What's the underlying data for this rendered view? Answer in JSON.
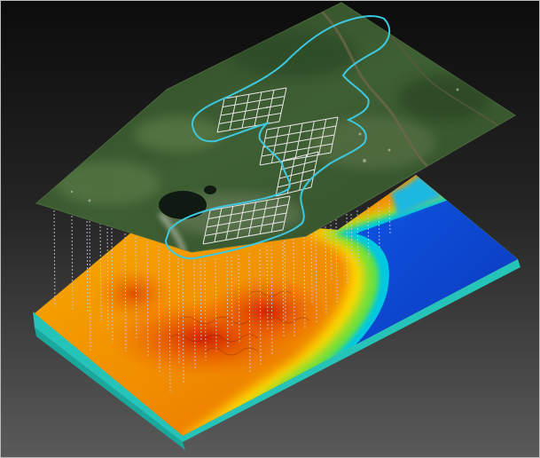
{
  "scene": {
    "background_colors": [
      "#0c0c0c",
      "#5a5a5a"
    ],
    "layers": [
      {
        "name": "aerial-imagery-surface",
        "colors": [
          "#2e4a26",
          "#3f6134",
          "#55723f",
          "#7a8a6b"
        ]
      },
      {
        "name": "geologic-model-surface",
        "colors": [
          "#f4a200",
          "#e43b00",
          "#ffe000",
          "#3fe08a",
          "#00c8e8",
          "#0060e0",
          "#0a34b8"
        ]
      }
    ],
    "outline_color": "#3ec8e0",
    "grid_color": "#e6e6e6",
    "drillhole_color": "#c8c8dc",
    "base_slab_color": "#28c8c0"
  }
}
